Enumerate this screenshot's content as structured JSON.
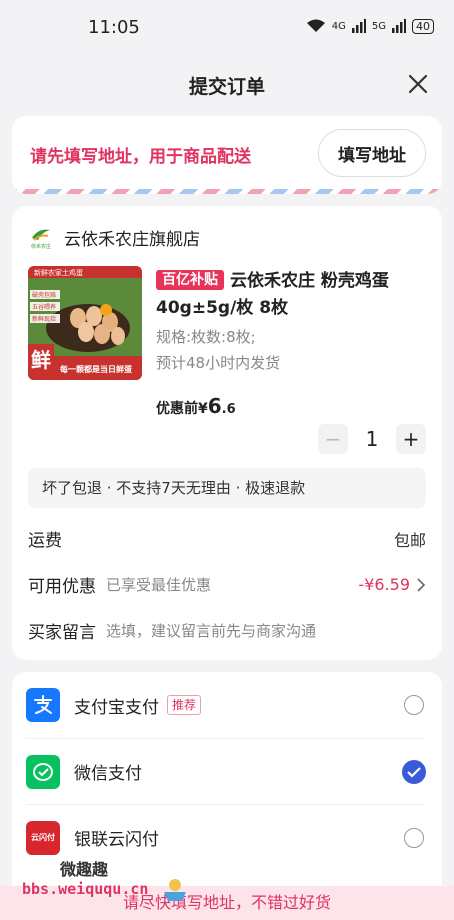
{
  "status": {
    "time": "11:05",
    "net1": "4G",
    "net2": "5G",
    "battery": "40"
  },
  "nav": {
    "title": "提交订单"
  },
  "address": {
    "prompt": "请先填写地址，用于商品配送",
    "button": "填写地址"
  },
  "shop": {
    "name": "云依禾农庄旗舰店",
    "logo_text": "依禾农庄"
  },
  "product": {
    "tag": "百亿补贴",
    "title": "云依禾农庄 粉壳鸡蛋40g±5g/枚 8枚",
    "spec": "规格:枚数:8枚;",
    "ship": "预计48小时内发货",
    "price_prefix": "优惠前¥",
    "price_int": "6",
    "price_dec": ".6",
    "quantity": "1",
    "image_texts": {
      "top": "新鲜农家土鸡蛋",
      "b1": "破壳包赔",
      "b2": "五谷喂养",
      "b3": "新鲜现捡",
      "fresh": "鲜",
      "slogan": "每一颗都是当日鲜蛋"
    }
  },
  "services": "坏了包退 · 不支持7天无理由 · 极速退款",
  "rows": {
    "freight_label": "运费",
    "freight_value": "包邮",
    "coupon_label": "可用优惠",
    "coupon_sub": "已享受最佳优惠",
    "coupon_value": "-¥6.59",
    "msg_label": "买家留言",
    "msg_placeholder": "选填，建议留言前先与商家沟通"
  },
  "payment": [
    {
      "name": "支付宝支付",
      "tag": "推荐",
      "icon": "alipay-icon",
      "checked": false
    },
    {
      "name": "微信支付",
      "icon": "wechat-pay-icon",
      "checked": true
    },
    {
      "name": "银联云闪付",
      "icon": "unionpay-icon",
      "checked": false,
      "icon_text": "云闪付"
    }
  ],
  "bottom_banner": "请尽快填写地址，不错过好货",
  "watermark": {
    "top": "微趣趣",
    "bottom": "bbs.weiququ.cn"
  },
  "colors": {
    "accent": "#e0335f",
    "check": "#3a5bd9",
    "alipay": "#1677ff",
    "wechat": "#07c160",
    "unionpay": "#d7262e"
  }
}
